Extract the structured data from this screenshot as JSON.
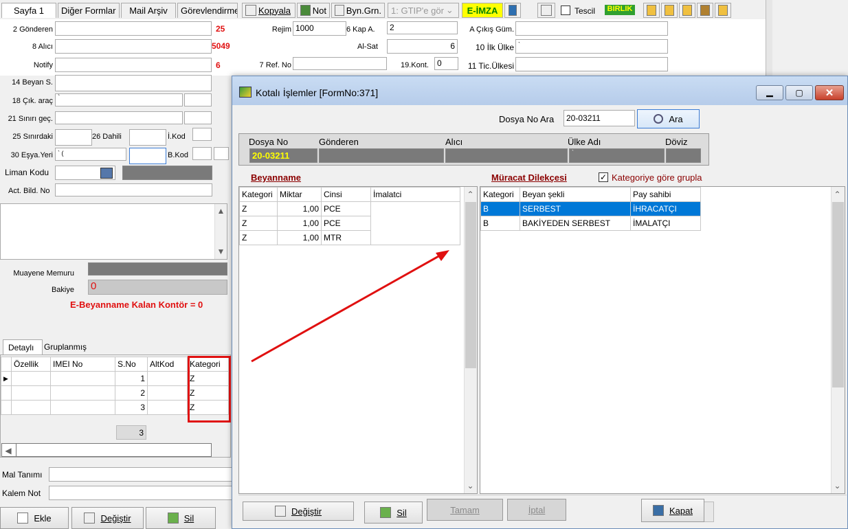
{
  "tabs": [
    "Sayfa 1",
    "Diğer Formlar",
    "Mail Arşiv",
    "Görevlendirme"
  ],
  "toolbar": {
    "kopyala": "Kopyala",
    "not": "Not",
    "byn": "Byn.Grn.",
    "gtip": "1: GTIP'e gör",
    "eimza": "E-İMZA",
    "tescil": "Tescil",
    "birlik": "BIRLIK"
  },
  "form": {
    "gonderen_label": "2 Gönderen",
    "gonderen_count": "25",
    "alici_label": "8 Alıcı",
    "alici_count": "5049",
    "notify_label": "Notify",
    "notify_count": "6",
    "beyan_label": "14 Beyan S.",
    "cik_label": "18 Çık. araç",
    "cik_value": "`",
    "sinir_label": "21 Sınırı geç.",
    "sinirdaki_label": "25 Sınırdaki",
    "dahili_label": "26 Dahili",
    "ikod_label": "İ.Kod",
    "esya_label": "30 Eşya.Yeri",
    "esya_value": "                          `      (",
    "bkod_label": "B.Kod",
    "liman_label": "Liman Kodu",
    "act_label": "Act. Bild. No",
    "rejim_label": "Rejim",
    "rejim_value": "1000",
    "kap_label": "6 Kap A.",
    "kap_value": "2",
    "alsat_label": "Al-Sat",
    "alsat_value": "6",
    "ref_label": "7 Ref. No",
    "kont_label": "19.Kont.",
    "kont_value": "0",
    "acikis_label": "A Çıkış Güm.",
    "ilk_label": "10 İlk Ülke",
    "ilk_value": "`",
    "tic_label": "11 Tic.Ülkesi",
    "muayene_label": "Muayene Memuru",
    "bakiye_label": "Bakiye",
    "bakiye_value": "0",
    "kontor": "E-Beyanname Kalan Kontör = 0"
  },
  "lower_tabs": [
    "Detaylı",
    "Gruplanmış"
  ],
  "lower_grid": {
    "headers": [
      "Özellik",
      "IMEI No",
      "S.No",
      "AltKod",
      "Kategori"
    ],
    "rows": [
      [
        "",
        "",
        "1",
        "",
        "Z"
      ],
      [
        "",
        "",
        "2",
        "",
        "Z"
      ],
      [
        "",
        "",
        "3",
        "",
        "Z"
      ]
    ],
    "total": "3"
  },
  "bottom": {
    "mal": "Mal Tanımı",
    "kalem": "Kalem Not",
    "ekle": "Ekle",
    "degistir": "Değiştir",
    "sil": "Sil"
  },
  "dialog": {
    "title": "Kotalı İşlemler [FormNo:371]",
    "search_label": "Dosya No Ara",
    "search_value": "20-03211",
    "search_btn": "Ara",
    "hdr": [
      "Dosya No",
      "Gönderen",
      "Alıcı",
      "Ülke Adı",
      "Döviz"
    ],
    "dosya_value": "20-03211",
    "ulke_value": "`",
    "beyanname": "Beyanname",
    "muracat": "Müracat Dilekçesi",
    "grupla": "Kategoriye göre grupla",
    "left_headers": [
      "Kategori",
      "Miktar",
      "Cinsi",
      "İmalatci"
    ],
    "left_rows": [
      [
        "Z",
        "1,00",
        "PCE",
        ""
      ],
      [
        "Z",
        "1,00",
        "PCE",
        ""
      ],
      [
        "Z",
        "1,00",
        "MTR",
        ""
      ]
    ],
    "right_headers": [
      "Kategori",
      "Beyan şekli",
      "Pay sahibi"
    ],
    "right_rows": [
      [
        "B",
        "SERBEST",
        "İHRACATÇI"
      ],
      [
        "B",
        "BAKİYEDEN SERBEST",
        "İMALATÇI"
      ]
    ],
    "btn_degistir": "Değiştir",
    "btn_sil": "Sil",
    "btn_tamam": "Tamam",
    "btn_iptal": "İptal",
    "btn_kapat": "Kapat"
  },
  "colors": {
    "highlight": "#0078d7",
    "label_red": "#8b0000",
    "yellow_text": "#ffff00",
    "eimza_bg": "#ffff00"
  }
}
